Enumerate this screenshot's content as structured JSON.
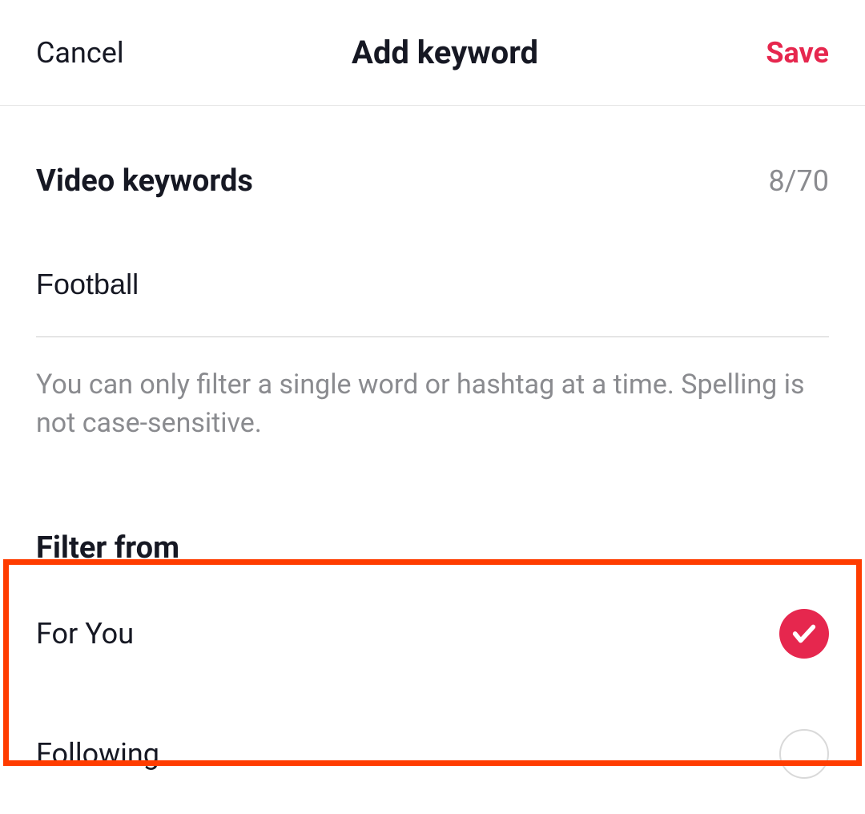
{
  "header": {
    "cancel": "Cancel",
    "title": "Add keyword",
    "save": "Save"
  },
  "keywords": {
    "label": "Video keywords",
    "counter": "8/70",
    "value": "Football",
    "help": "You can only filter a single word or hashtag at a time. Spelling is not case-sensitive."
  },
  "filter": {
    "label": "Filter from",
    "options": [
      {
        "label": "For You",
        "checked": true
      },
      {
        "label": "Following",
        "checked": false
      }
    ]
  },
  "colors": {
    "accent": "#e6274e",
    "highlight": "#ff3c00"
  }
}
